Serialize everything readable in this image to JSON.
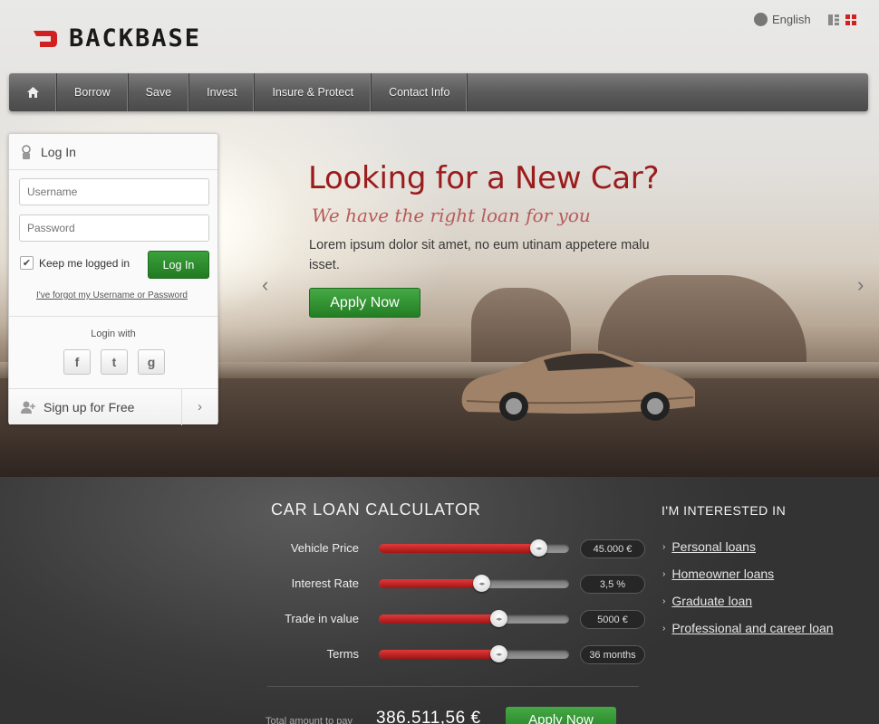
{
  "brand": {
    "name": "BACKBASE",
    "accent": "#d22020"
  },
  "header": {
    "language": "English"
  },
  "nav": {
    "items": [
      {
        "label": "Borrow"
      },
      {
        "label": "Save"
      },
      {
        "label": "Invest"
      },
      {
        "label": "Insure & Protect"
      },
      {
        "label": "Contact Info"
      }
    ]
  },
  "login": {
    "title": "Log In",
    "username_placeholder": "Username",
    "password_placeholder": "Password",
    "remember_label": "Keep me logged in",
    "remember_checked": true,
    "login_button": "Log In",
    "forgot_link": "I've forgot my Username or Password",
    "login_with": "Login with",
    "social": [
      {
        "icon": "facebook-icon",
        "glyph": "f"
      },
      {
        "icon": "twitter-icon",
        "glyph": "t"
      },
      {
        "icon": "google-icon",
        "glyph": "g"
      }
    ],
    "signup_label": "Sign up for Free"
  },
  "hero": {
    "title": "Looking for a New Car?",
    "subtitle": "We have the right loan for you",
    "text": "Lorem ipsum dolor sit amet, no eum utinam appetere malu isset.",
    "apply_button": "Apply Now"
  },
  "calculator": {
    "title": "CAR LOAN CALCULATOR",
    "rows": [
      {
        "label": "Vehicle Price",
        "value": "45.000 €",
        "fraction": 0.84
      },
      {
        "label": "Interest Rate",
        "value": "3,5 %",
        "fraction": 0.54
      },
      {
        "label": "Trade in value",
        "value": "5000 €",
        "fraction": 0.63
      },
      {
        "label": "Terms",
        "value": "36 months",
        "fraction": 0.63
      }
    ],
    "total_label": "Total amount to pay",
    "total_value": "386.511,56 €",
    "apply_button": "Apply Now"
  },
  "interest": {
    "title": "I'M INTERESTED IN",
    "links": [
      {
        "label": "Personal loans"
      },
      {
        "label": "Homeowner loans"
      },
      {
        "label": "Graduate loan"
      },
      {
        "label": "Professional and career loan"
      }
    ]
  }
}
